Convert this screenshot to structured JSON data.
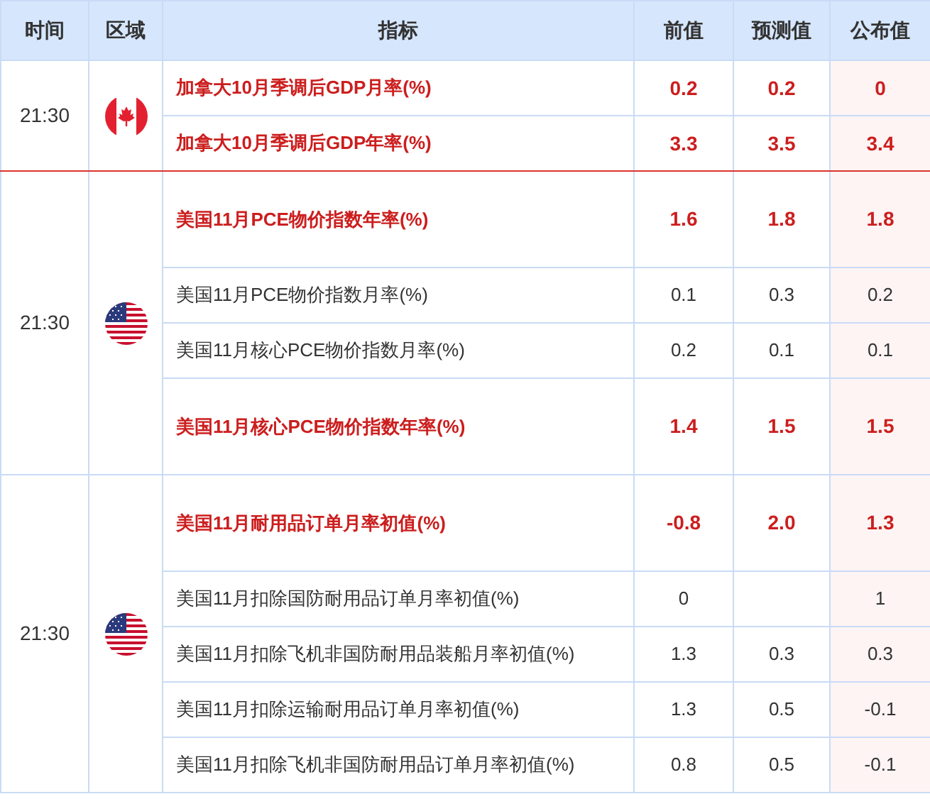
{
  "columns": [
    "时间",
    "区域",
    "指标",
    "前值",
    "预测值",
    "公布值"
  ],
  "groups": [
    {
      "time": "21:30",
      "kind": "canada",
      "rows": [
        {
          "indicator": "加拿大10月季调后GDP月率(%)",
          "previous": "0.2",
          "forecast": "0.2",
          "actual": "0",
          "important": true
        },
        {
          "indicator": "加拿大10月季调后GDP年率(%)",
          "previous": "3.3",
          "forecast": "3.5",
          "actual": "3.4",
          "important": true
        }
      ]
    },
    {
      "time": "21:30",
      "kind": "usa",
      "rows": [
        {
          "indicator": "美国11月PCE物价指数年率(%)",
          "previous": "1.6",
          "forecast": "1.8",
          "actual": "1.8",
          "important": true
        },
        {
          "indicator": "美国11月PCE物价指数月率(%)",
          "previous": "0.1",
          "forecast": "0.3",
          "actual": "0.2",
          "important": false
        },
        {
          "indicator": "美国11月核心PCE物价指数月率(%)",
          "previous": "0.2",
          "forecast": "0.1",
          "actual": "0.1",
          "important": false
        },
        {
          "indicator": "美国11月核心PCE物价指数年率(%)",
          "previous": "1.4",
          "forecast": "1.5",
          "actual": "1.5",
          "important": true
        }
      ]
    },
    {
      "time": "21:30",
      "kind": "usa",
      "rows": [
        {
          "indicator": "美国11月耐用品订单月率初值(%)",
          "previous": "-0.8",
          "forecast": "2.0",
          "actual": "1.3",
          "important": true
        },
        {
          "indicator": "美国11月扣除国防耐用品订单月率初值(%)",
          "previous": "0",
          "actual": "1",
          "important": false
        },
        {
          "indicator": "美国11月扣除飞机非国防耐用品装船月率初值(%)",
          "previous": "1.3",
          "forecast": "0.3",
          "actual": "0.3",
          "important": false
        },
        {
          "indicator": "美国11月扣除运输耐用品订单月率初值(%)",
          "previous": "1.3",
          "forecast": "0.5",
          "actual": "-0.1",
          "important": false
        },
        {
          "indicator": "美国11月扣除飞机非国防耐用品订单月率初值(%)",
          "previous": "0.8",
          "forecast": "0.5",
          "actual": "-0.1",
          "important": false
        }
      ]
    }
  ]
}
